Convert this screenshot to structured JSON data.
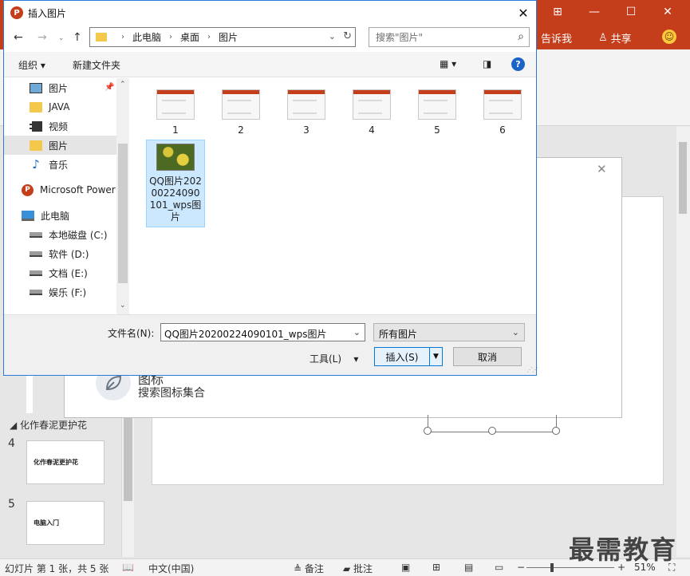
{
  "dialog": {
    "title": "插入图片",
    "address": {
      "segments": [
        "此电脑",
        "桌面",
        "图片"
      ]
    },
    "search": {
      "placeholder": "搜索\"图片\""
    },
    "toolbar": {
      "organize": "组织 ▾",
      "new_folder": "新建文件夹"
    },
    "nav_items": [
      {
        "label": "图片",
        "icon": "picture-icon",
        "pinned": true
      },
      {
        "label": "JAVA",
        "icon": "folder-icon"
      },
      {
        "label": "视频",
        "icon": "video-icon"
      },
      {
        "label": "图片",
        "icon": "folder-icon",
        "selected": true
      },
      {
        "label": "音乐",
        "icon": "music-icon"
      },
      {
        "label": "Microsoft Power",
        "icon": "powerpoint-icon"
      },
      {
        "label": "此电脑",
        "icon": "computer-icon"
      },
      {
        "label": "本地磁盘 (C:)",
        "icon": "drive-icon"
      },
      {
        "label": "软件 (D:)",
        "icon": "drive-icon"
      },
      {
        "label": "文档 (E:)",
        "icon": "drive-icon"
      },
      {
        "label": "娱乐 (F:)",
        "icon": "drive-icon"
      }
    ],
    "files": [
      {
        "name": "1"
      },
      {
        "name": "2"
      },
      {
        "name": "3"
      },
      {
        "name": "4"
      },
      {
        "name": "5"
      },
      {
        "name": "6"
      },
      {
        "name": "QQ图片20200224090101_wps图片",
        "selected": true
      }
    ],
    "filename_label": "文件名(N):",
    "filename_value": "QQ图片20200224090101_wps图片",
    "filter_value": "所有图片",
    "tools_label": "工具(L)",
    "insert_label": "插入(S)",
    "cancel_label": "取消"
  },
  "ppt": {
    "tell_me": "告诉我",
    "share": "共享",
    "section_label": "化作春泥更护花",
    "slides": [
      {
        "number": "4",
        "text": "化作春泥更护花"
      },
      {
        "number": "5",
        "text": "电脑入门"
      }
    ],
    "popup": {
      "title": "图标",
      "subtitle": "搜索图标集合"
    },
    "status": {
      "slide_info": "幻灯片 第 1 张，共 5 张",
      "language": "中文(中国)",
      "notes": "备注",
      "comments": "批注",
      "zoom": "51%"
    },
    "watermark": "最需教育"
  },
  "colors": {
    "ppt_brand": "#c43e1c",
    "selection": "#cce8ff",
    "accent": "#0078d7"
  }
}
